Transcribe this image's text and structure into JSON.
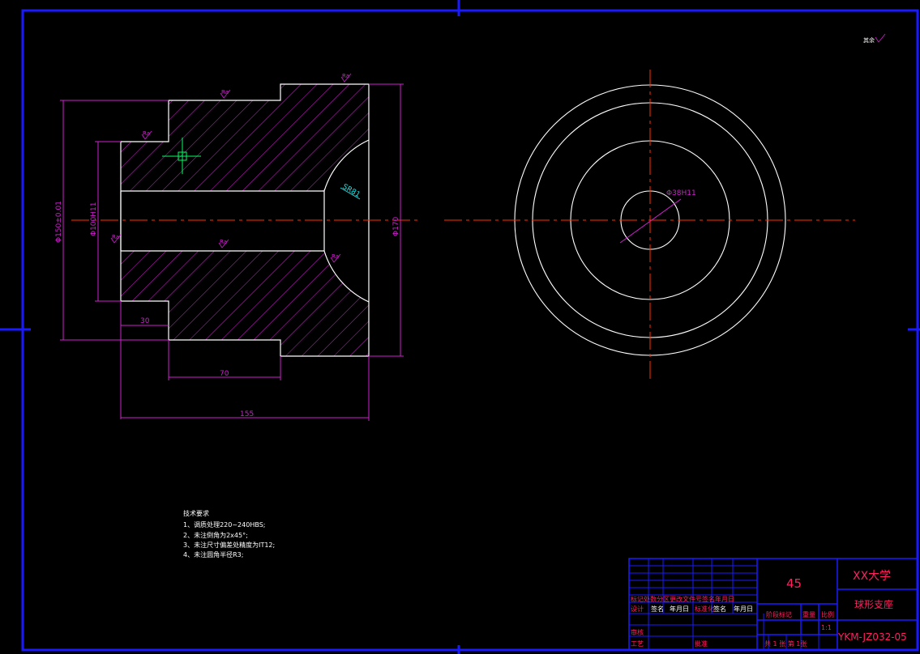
{
  "colors": {
    "background": "#000000",
    "frame": "#1a1aff",
    "outline": "#ffffff",
    "dimension": "#d020d0",
    "hatch": "#d020d0",
    "centerline": "#ff3000",
    "annotation_cyan": "#20e0e0",
    "ucs_icon": "#00ff60",
    "title_text": "#ff2060"
  },
  "dimensions": {
    "dia_150": "Φ150±0.01",
    "dia_100": "Φ100H11",
    "dia_170": "Φ170",
    "len_30": "30",
    "len_70": "70",
    "len_155": "155",
    "sphere": "SR81",
    "bore": "Φ38H11"
  },
  "roughness": {
    "r1": "Ra",
    "r2": "Ra",
    "r3": "Ra",
    "r4": "Ra",
    "r5": "Ra",
    "r6": "Ra",
    "other": "其余"
  },
  "tech_requirements": {
    "heading": "技术要求",
    "items": [
      "1、调质处理220~240HBS;",
      "2、未注倒角为2x45°;",
      "3、未注尺寸偏差处精度为IT12;",
      "4、未注圆角半径R3;"
    ]
  },
  "title_block": {
    "material": "45",
    "university": "XX大学",
    "part_name": "球形支座",
    "drawing_no": "YKM-JZ032-05",
    "scale": "1:1",
    "row_change_header": "标记处数分区更改文件号签名年月日",
    "designer_label": "设计",
    "sign_label": "签名",
    "date_label": "年月日",
    "standard_label": "标准化",
    "sign_label_2": "签名",
    "date_label_2": "年月日",
    "stage_label": "阶段标记",
    "weight_label": "重量",
    "scale_label": "比例",
    "review_label": "审核",
    "craft_label": "工艺",
    "approve_label": "批准",
    "sheets_label": "共 1 张 第 1张"
  }
}
